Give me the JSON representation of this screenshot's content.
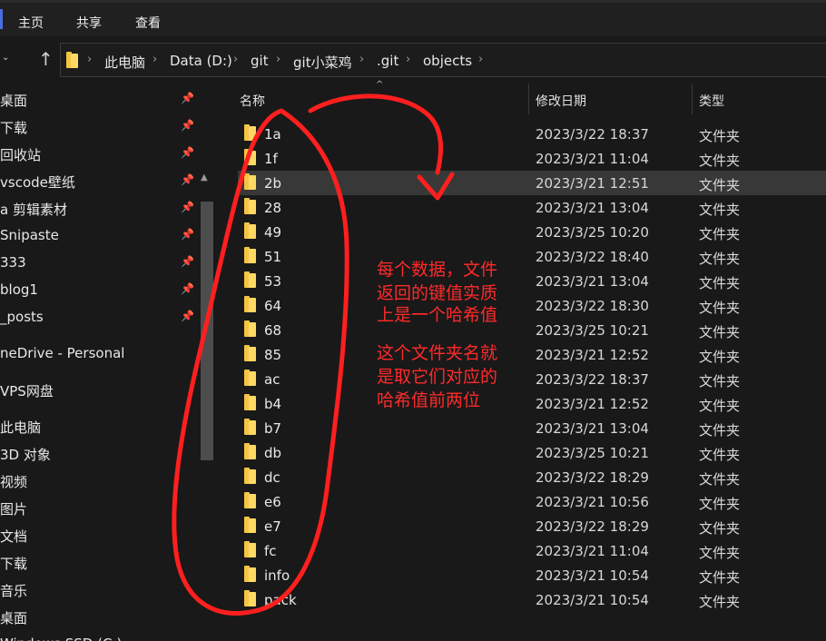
{
  "ribbon": {
    "tabs": [
      "主页",
      "共享",
      "查看"
    ]
  },
  "address": {
    "crumbs": [
      "此电脑",
      "Data (D:)",
      "git",
      "git小菜鸡",
      ".git",
      "objects"
    ]
  },
  "sidebar": {
    "items": [
      {
        "label": "桌面",
        "pinned": true
      },
      {
        "label": "下载",
        "pinned": true
      },
      {
        "label": "回收站",
        "pinned": true
      },
      {
        "label": "vscode壁纸",
        "pinned": true
      },
      {
        "label": "a 剪辑素材",
        "pinned": true
      },
      {
        "label": "Snipaste",
        "pinned": true
      },
      {
        "label": "333",
        "pinned": true
      },
      {
        "label": "blog1",
        "pinned": true
      },
      {
        "label": "_posts",
        "pinned": true
      },
      {
        "label": "neDrive - Personal",
        "pinned": false
      },
      {
        "label": "VPS网盘",
        "pinned": false
      },
      {
        "label": "此电脑",
        "pinned": false
      },
      {
        "label": "3D 对象",
        "pinned": false
      },
      {
        "label": "视频",
        "pinned": false
      },
      {
        "label": "图片",
        "pinned": false
      },
      {
        "label": "文档",
        "pinned": false
      },
      {
        "label": "下载",
        "pinned": false
      },
      {
        "label": "音乐",
        "pinned": false
      },
      {
        "label": "桌面",
        "pinned": false
      },
      {
        "label": "Windows SSD (C:)",
        "pinned": false
      }
    ]
  },
  "columns": {
    "name": "名称",
    "date": "修改日期",
    "type": "类型"
  },
  "files": [
    {
      "name": "1a",
      "date": "2023/3/22 18:37",
      "type": "文件夹"
    },
    {
      "name": "1f",
      "date": "2023/3/21 11:04",
      "type": "文件夹"
    },
    {
      "name": "2b",
      "date": "2023/3/21 12:51",
      "type": "文件夹"
    },
    {
      "name": "28",
      "date": "2023/3/21 13:04",
      "type": "文件夹"
    },
    {
      "name": "49",
      "date": "2023/3/25 10:20",
      "type": "文件夹"
    },
    {
      "name": "51",
      "date": "2023/3/22 18:40",
      "type": "文件夹"
    },
    {
      "name": "53",
      "date": "2023/3/21 13:04",
      "type": "文件夹"
    },
    {
      "name": "64",
      "date": "2023/3/22 18:30",
      "type": "文件夹"
    },
    {
      "name": "68",
      "date": "2023/3/25 10:21",
      "type": "文件夹"
    },
    {
      "name": "85",
      "date": "2023/3/21 12:52",
      "type": "文件夹"
    },
    {
      "name": "ac",
      "date": "2023/3/22 18:37",
      "type": "文件夹"
    },
    {
      "name": "b4",
      "date": "2023/3/21 12:52",
      "type": "文件夹"
    },
    {
      "name": "b7",
      "date": "2023/3/21 13:04",
      "type": "文件夹"
    },
    {
      "name": "db",
      "date": "2023/3/25 10:21",
      "type": "文件夹"
    },
    {
      "name": "dc",
      "date": "2023/3/22 18:29",
      "type": "文件夹"
    },
    {
      "name": "e6",
      "date": "2023/3/21 10:56",
      "type": "文件夹"
    },
    {
      "name": "e7",
      "date": "2023/3/22 18:29",
      "type": "文件夹"
    },
    {
      "name": "fc",
      "date": "2023/3/21 11:04",
      "type": "文件夹"
    },
    {
      "name": "info",
      "date": "2023/3/21 10:54",
      "type": "文件夹"
    },
    {
      "name": "pack",
      "date": "2023/3/21 10:54",
      "type": "文件夹"
    }
  ],
  "selected_index": 2,
  "annotation": {
    "lines": [
      "每个数据，文件",
      "返回的键值实质",
      "上是一个哈希值",
      "",
      "这个文件夹名就",
      "是取它们对应的",
      "哈希值前两位"
    ],
    "color": "#ff2a2a"
  }
}
